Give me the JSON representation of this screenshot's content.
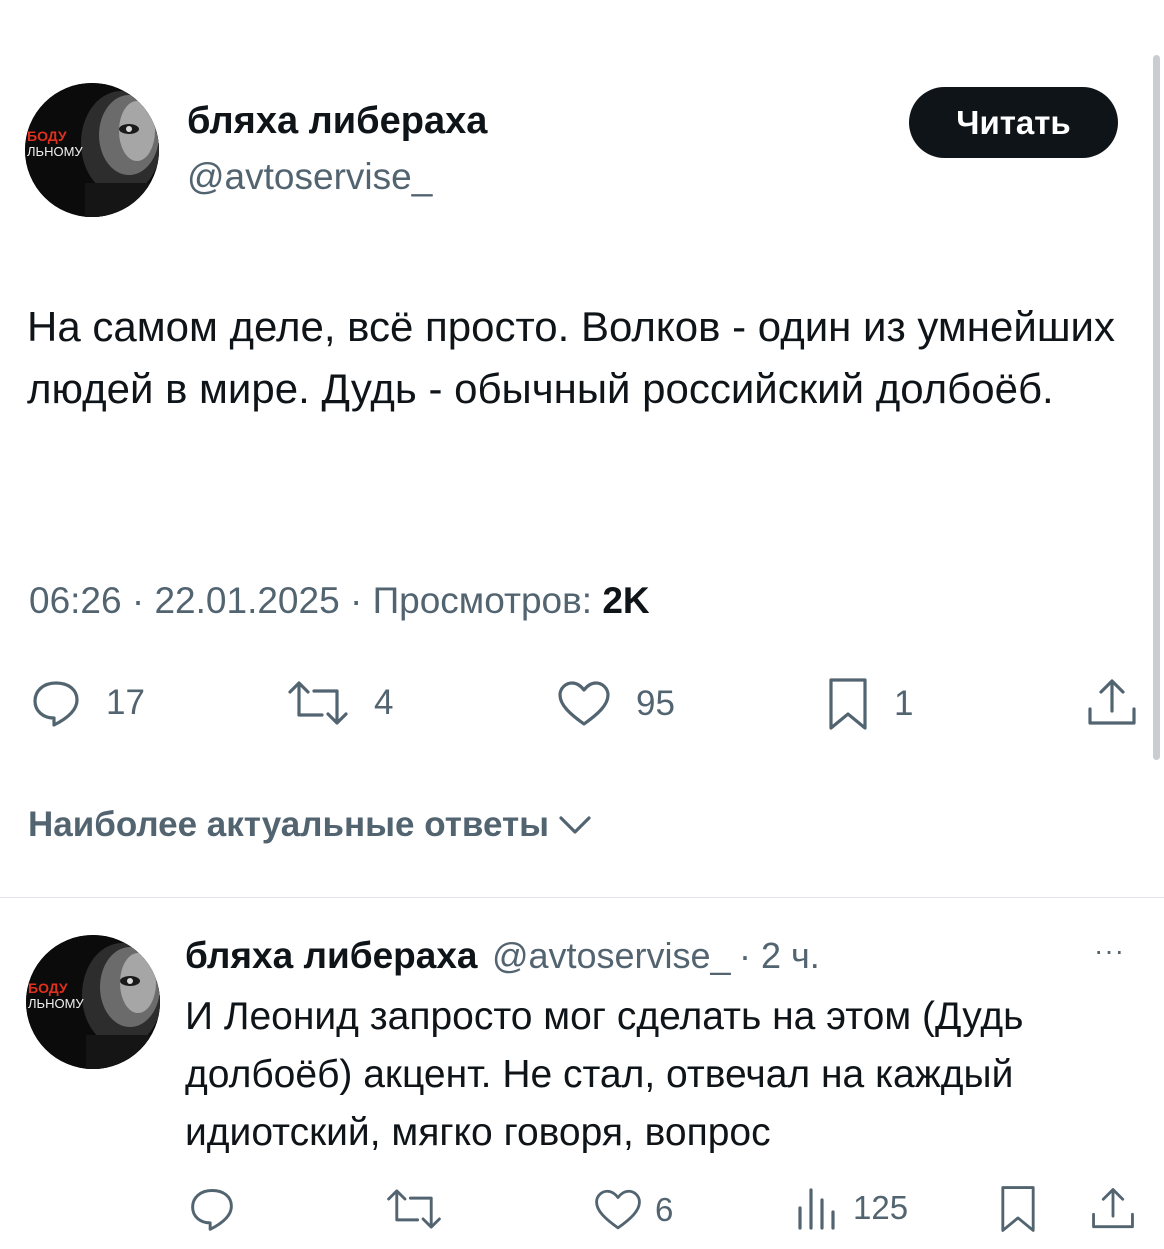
{
  "post": {
    "author_name": "бляха либераха",
    "author_handle": "@avtoservise_",
    "follow_label": "Читать",
    "text": "На самом деле, всё просто. Волков - один из умнейших людей в мире. Дудь - обычный российский долбоёб.",
    "time": "06:26",
    "date": "22.01.2025",
    "views_label": "Просмотров:",
    "views_value": "2K",
    "separator": "·",
    "stats": {
      "replies": "17",
      "reposts": "4",
      "likes": "95",
      "bookmarks": "1"
    }
  },
  "replies_sort": {
    "label": "Наиболее актуальные ответы"
  },
  "reply": {
    "author_name": "бляха либераха",
    "author_handle": "@avtoservise_",
    "time_ago": "· 2 ч.",
    "more_label": "···",
    "text": "И Леонид запросто мог сделать на этом (Дудь долбоёб) акцент. Не стал, отвечал на каждый идиотский, мягко говоря, вопрос",
    "stats": {
      "likes": "6",
      "views": "125"
    }
  },
  "avatar_overlay": {
    "line1": "БОДУ",
    "line2": "ЛЬНОМУ",
    "accent_color": "#e0301e"
  },
  "colors": {
    "text_primary": "#0f1419",
    "text_secondary": "#536471",
    "button_bg": "#0f1419",
    "button_text": "#ffffff"
  }
}
